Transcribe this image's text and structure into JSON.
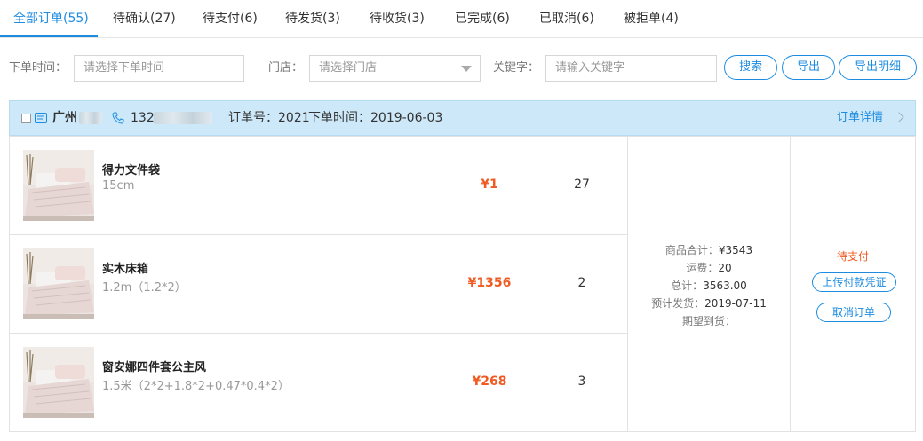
{
  "tabs": [
    {
      "label": "全部订单(55)"
    },
    {
      "label": "待确认(27)"
    },
    {
      "label": "待支付(6)"
    },
    {
      "label": "待发货(3)"
    },
    {
      "label": "待收货(3)"
    },
    {
      "label": "已完成(6)"
    },
    {
      "label": "已取消(6)"
    },
    {
      "label": "被拒单(4)"
    }
  ],
  "filters": {
    "order_time_label": "下单时间：",
    "order_time_placeholder": "请选择下单时间",
    "store_label": "门店：",
    "store_placeholder": "请选择门店",
    "keyword_label": "关键字：",
    "keyword_placeholder": "请输入关键字",
    "search_button": "搜索",
    "export_button": "导出",
    "export_detail_button": "导出明细"
  },
  "order": {
    "city": "广州",
    "phone_prefix": "132",
    "order_no": "订单号：2021",
    "order_time": "下单时间：2019-06-03",
    "detail_link": "订单详情",
    "items": [
      {
        "name": "得力文件袋",
        "spec": "15cm",
        "price": "¥1",
        "qty": "27"
      },
      {
        "name": "实木床箱",
        "spec": "1.2m（1.2*2）",
        "price": "¥1356",
        "qty": "2"
      },
      {
        "name": "窗安娜四件套公主风",
        "spec": "1.5米（2*2+1.8*2+0.47*0.4*2）",
        "price": "¥268",
        "qty": "3"
      }
    ],
    "summary": {
      "goods_total_label": "商品合计：",
      "goods_total": "¥3543",
      "shipping_label": "运费：",
      "shipping": "20",
      "total_label": "总计：",
      "total": "3563.00",
      "est_ship_label": "预计发货：",
      "est_ship": "2019-07-11",
      "expected_arrival_label": "期望到货：",
      "expected_arrival": ""
    },
    "status": "待支付",
    "upload_button": "上传付款凭证",
    "cancel_button": "取消订单"
  },
  "colors": {
    "accent": "#1d8ce0",
    "price": "#f05a23",
    "header_bg": "#cde8f8"
  }
}
